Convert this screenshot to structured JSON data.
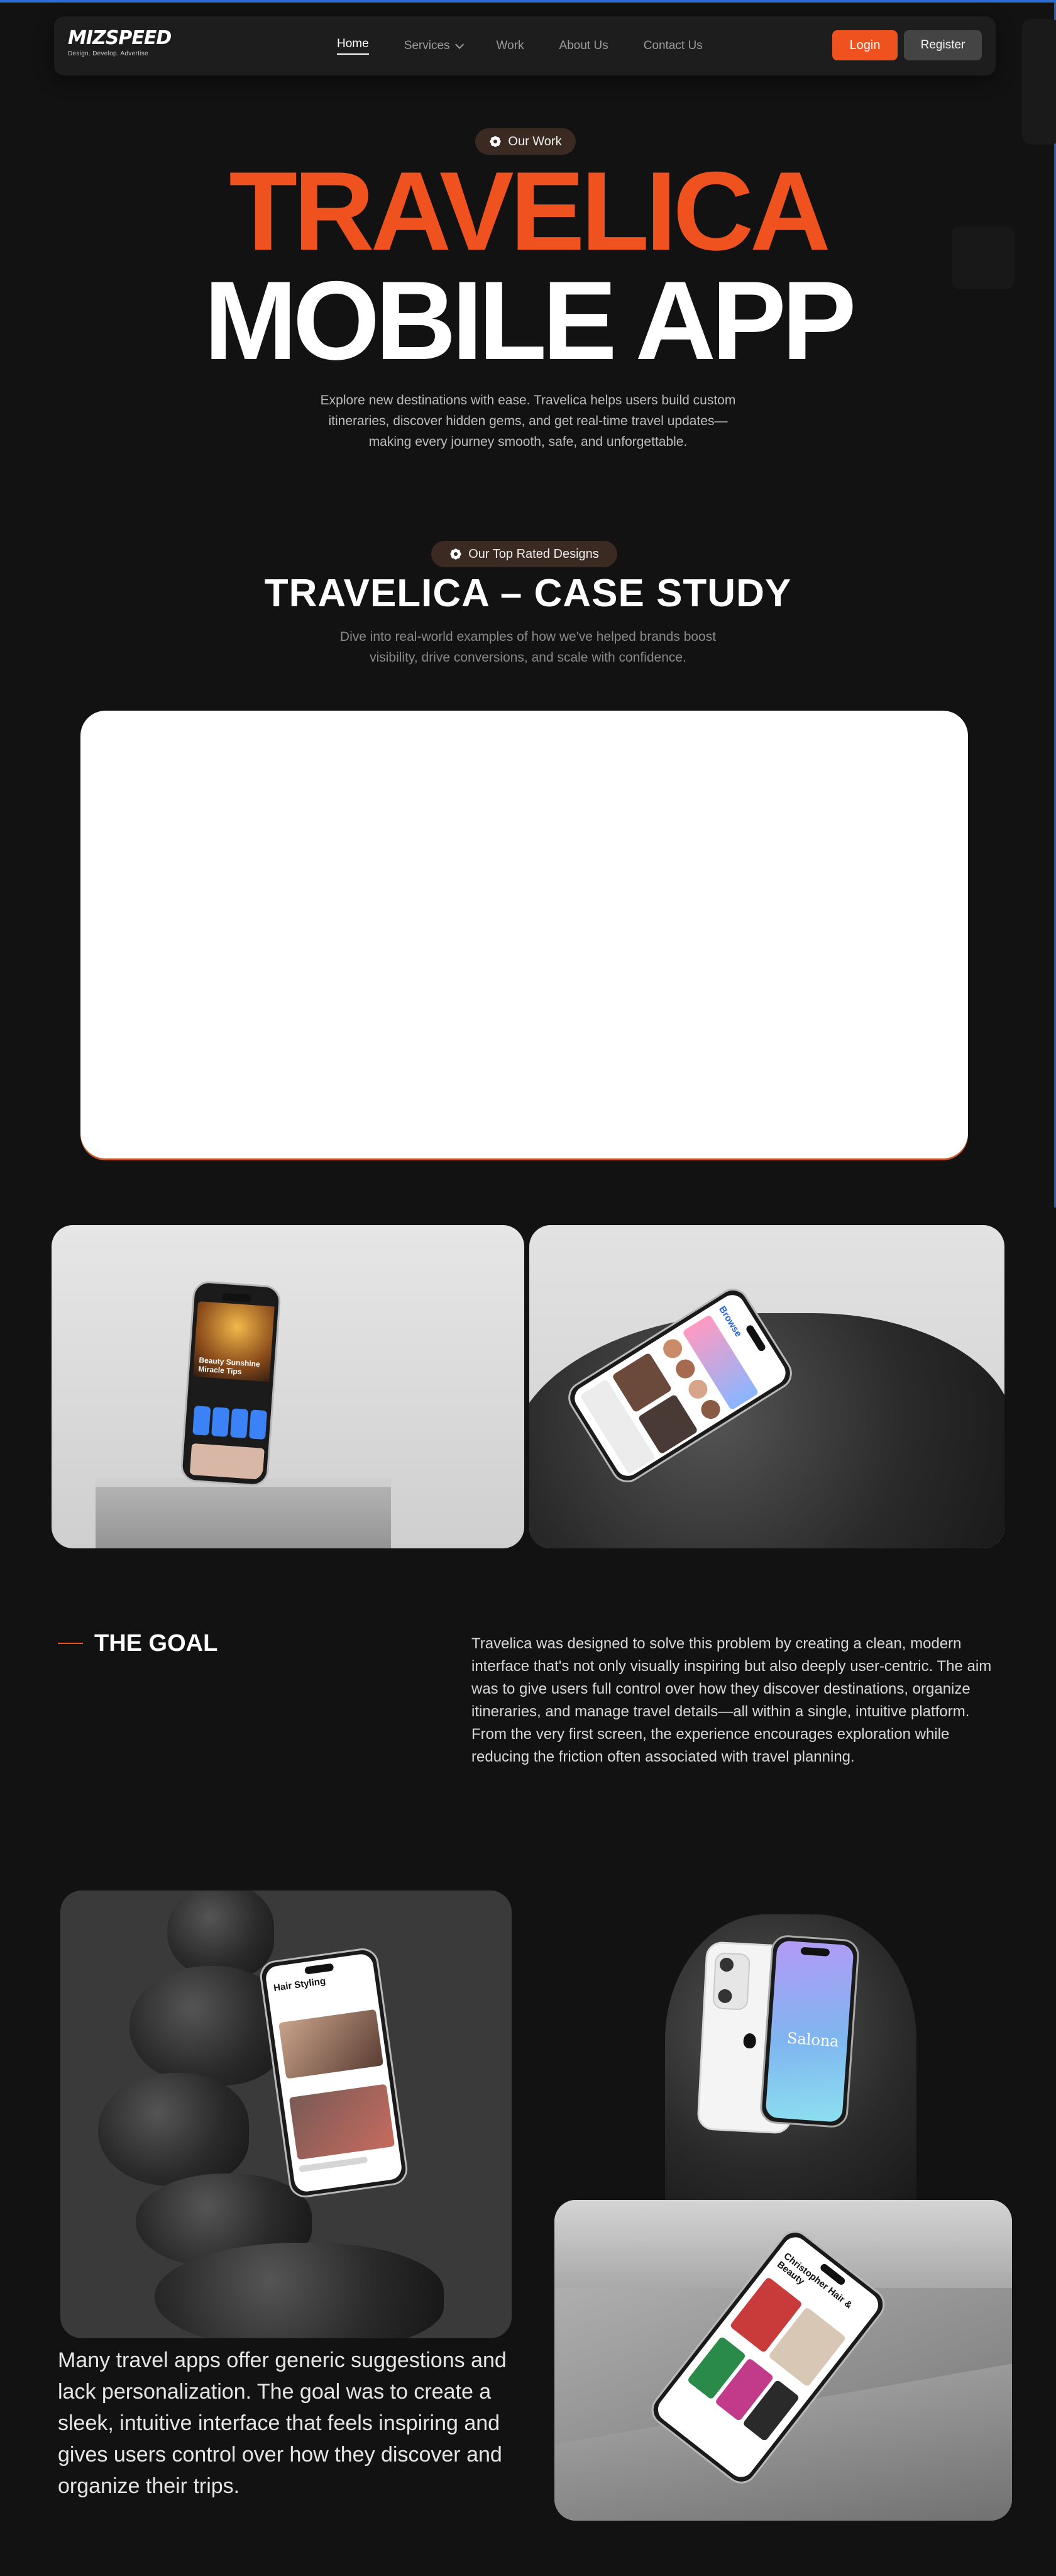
{
  "nav": {
    "logo_text": "MIZSPEED",
    "logo_tagline": "Design. Develop. Advertise",
    "links": [
      "Home",
      "Services",
      "Work",
      "About Us",
      "Contact Us"
    ],
    "login_label": "Login",
    "register_label": "Register"
  },
  "hero": {
    "pill_label": "Our Work",
    "title_line1": "TRAVELICA",
    "title_line2": "MOBILE APP",
    "description": "Explore new destinations with ease. Travelica helps users build custom itineraries, discover hidden gems, and get real-time travel updates—making every journey smooth, safe, and unforgettable."
  },
  "case_study": {
    "pill_label": "Our Top Rated Designs",
    "title": "TRAVELICA – CASE STUDY",
    "description": "Dive into real-world examples of how we've helped brands boost visibility, drive conversions, and scale with confidence."
  },
  "mockups": {
    "p1_screen_title": "Beauty Sunshine Miracle Tips",
    "p2_screen_title": "Browse",
    "p3_screen_title": "Hair Styling",
    "p4_screen_title": "Salona",
    "p5_screen_title": "Christopher Hair & Beauty"
  },
  "goal": {
    "heading": "THE GOAL",
    "text": "Travelica was designed to solve this problem by creating a clean, modern interface that's not only visually inspiring but also deeply user-centric. The aim was to give users full control over how they discover destinations, organize itineraries, and manage travel details—all within a single, intuitive platform. From the very first screen, the experience encourages exploration while reducing the friction often associated with travel planning."
  },
  "bottom": {
    "text": "Many travel apps offer generic suggestions and lack personalization. The goal was to create a sleek, intuitive interface that feels inspiring and gives users control over how they discover and organize their trips."
  },
  "colors": {
    "accent": "#f0521f",
    "background": "#121212",
    "nav_bg": "#1d1d1d"
  }
}
